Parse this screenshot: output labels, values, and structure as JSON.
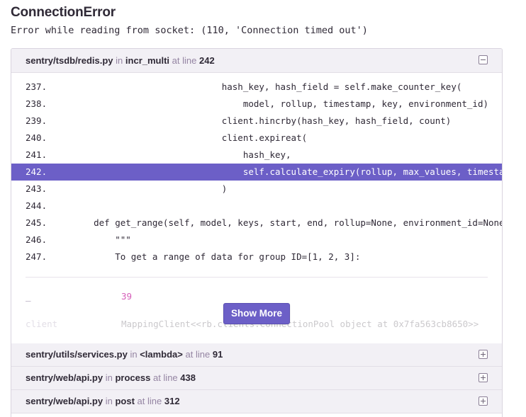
{
  "error": {
    "title": "ConnectionError",
    "message": "Error while reading from socket: (110, 'Connection timed out')"
  },
  "frames": [
    {
      "file": "sentry/tsdb/redis.py",
      "in_label": "in",
      "function": "incr_multi",
      "at_label": "at line",
      "line": "242",
      "expanded": true
    },
    {
      "file": "sentry/utils/services.py",
      "in_label": "in",
      "function": "<lambda>",
      "at_label": "at line",
      "line": "91",
      "expanded": false
    },
    {
      "file": "sentry/web/api.py",
      "in_label": "in",
      "function": "process",
      "at_label": "at line",
      "line": "438",
      "expanded": false
    },
    {
      "file": "sentry/web/api.py",
      "in_label": "in",
      "function": "post",
      "at_label": "at line",
      "line": "312",
      "expanded": false
    }
  ],
  "code_lines": [
    {
      "num": "237.",
      "src": "                            hash_key, hash_field = self.make_counter_key("
    },
    {
      "num": "238.",
      "src": "                                model, rollup, timestamp, key, environment_id)"
    },
    {
      "num": "239.",
      "src": "                            client.hincrby(hash_key, hash_field, count)"
    },
    {
      "num": "240.",
      "src": "                            client.expireat("
    },
    {
      "num": "241.",
      "src": "                                hash_key,"
    },
    {
      "num": "242.",
      "src": "                                self.calculate_expiry(rollup, max_values, timestamp),"
    },
    {
      "num": "243.",
      "src": "                            )"
    },
    {
      "num": "244.",
      "src": ""
    },
    {
      "num": "245.",
      "src": "    def get_range(self, model, keys, start, end, rollup=None, environment_id=None):"
    },
    {
      "num": "246.",
      "src": "        \"\"\""
    },
    {
      "num": "247.",
      "src": "        To get a range of data for group ID=[1, 2, 3]:"
    }
  ],
  "active_line": "242.",
  "variables": [
    {
      "key": "_",
      "value": "39"
    },
    {
      "key": "client",
      "value": "MappingClient<<rb.clients.ConnectionPool object at 0x7fa563cb8650>>"
    }
  ],
  "show_more_label": "Show More"
}
